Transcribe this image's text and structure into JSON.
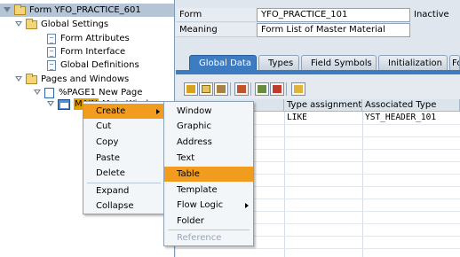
{
  "tree": {
    "root": "Form YFO_PRACTICE_601",
    "global_settings": "Global Settings",
    "gs_items": [
      "Form Attributes",
      "Form Interface",
      "Global Definitions"
    ],
    "pages_windows": "Pages and Windows",
    "page": "%PAGE1 New Page",
    "window_node": "MAIN",
    "window_text": "Main Window"
  },
  "header": {
    "form_label": "Form",
    "form_value": "YFO_PRACTICE_101",
    "status": "Inactive",
    "meaning_label": "Meaning",
    "meaning_value": "Form List of Master Material"
  },
  "tabs": [
    "Global Data",
    "Types",
    "Field Symbols",
    "Initialization",
    "Fo"
  ],
  "table": {
    "columns": [
      "Type assignment",
      "Associated Type"
    ],
    "rows": [
      {
        "type_assignment": "LIKE",
        "associated_type": "YST_HEADER_101"
      }
    ]
  },
  "context_menu": {
    "items": [
      "Create",
      "Cut",
      "Copy",
      "Paste",
      "Delete",
      "Expand",
      "Collapse"
    ]
  },
  "create_submenu": {
    "items": [
      "Window",
      "Graphic",
      "Address",
      "Text",
      "Table",
      "Template",
      "Flow Logic",
      "Folder",
      "Reference"
    ],
    "highlighted": "Table",
    "disabled": "Reference"
  },
  "colors": {
    "highlight": "#f29c1f",
    "tab_active": "#3e7cc2",
    "tree_selected": "#b5c5d5"
  }
}
